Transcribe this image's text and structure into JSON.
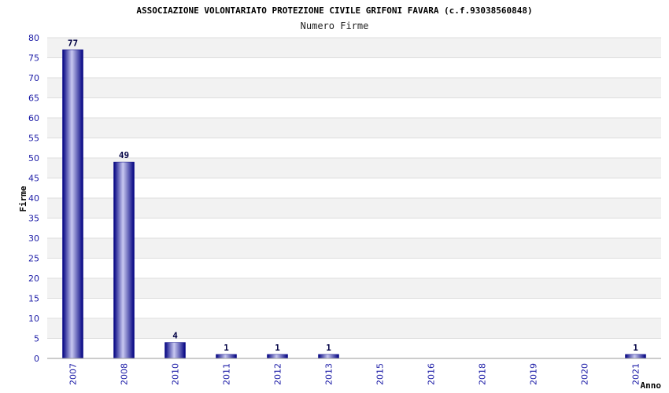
{
  "chart_data": {
    "type": "bar",
    "title": "ASSOCIAZIONE VOLONTARIATO PROTEZIONE CIVILE GRIFONI FAVARA (c.f.93038560848)",
    "subtitle": "Numero Firme",
    "xlabel": "Anno",
    "ylabel": "Firme",
    "ylim": [
      0,
      80
    ],
    "yticks": [
      "0",
      "5",
      "10",
      "15",
      "20",
      "25",
      "30",
      "35",
      "40",
      "45",
      "50",
      "55",
      "60",
      "65",
      "70",
      "75",
      "80"
    ],
    "categories": [
      "2007",
      "2008",
      "2010",
      "2011",
      "2012",
      "2013",
      "2015",
      "2016",
      "2018",
      "2019",
      "2020",
      "2021"
    ],
    "values": [
      77,
      49,
      4,
      1,
      1,
      1,
      null,
      null,
      null,
      null,
      null,
      1
    ],
    "grid": true,
    "colors": {
      "bar_dark": "#000080",
      "bar_light": "#c8c8f0",
      "band": "#f2f2f2",
      "tick_text": "#1a1aa6"
    }
  }
}
